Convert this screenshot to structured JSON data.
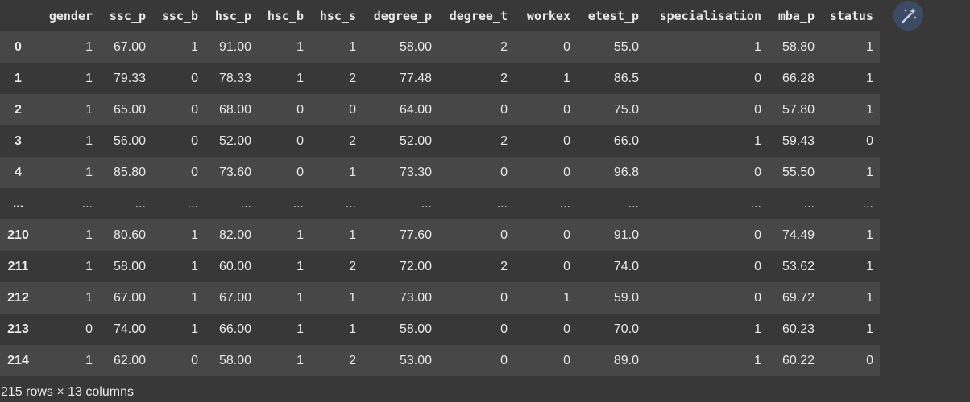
{
  "table": {
    "columns": [
      "",
      "gender",
      "ssc_p",
      "ssc_b",
      "hsc_p",
      "hsc_b",
      "hsc_s",
      "degree_p",
      "degree_t",
      "workex",
      "etest_p",
      "specialisation",
      "mba_p",
      "status"
    ],
    "rows": [
      [
        "0",
        "1",
        "67.00",
        "1",
        "91.00",
        "1",
        "1",
        "58.00",
        "2",
        "0",
        "55.0",
        "1",
        "58.80",
        "1"
      ],
      [
        "1",
        "1",
        "79.33",
        "0",
        "78.33",
        "1",
        "2",
        "77.48",
        "2",
        "1",
        "86.5",
        "0",
        "66.28",
        "1"
      ],
      [
        "2",
        "1",
        "65.00",
        "0",
        "68.00",
        "0",
        "0",
        "64.00",
        "0",
        "0",
        "75.0",
        "0",
        "57.80",
        "1"
      ],
      [
        "3",
        "1",
        "56.00",
        "0",
        "52.00",
        "0",
        "2",
        "52.00",
        "2",
        "0",
        "66.0",
        "1",
        "59.43",
        "0"
      ],
      [
        "4",
        "1",
        "85.80",
        "0",
        "73.60",
        "0",
        "1",
        "73.30",
        "0",
        "0",
        "96.8",
        "0",
        "55.50",
        "1"
      ],
      [
        "...",
        "...",
        "...",
        "...",
        "...",
        "...",
        "...",
        "...",
        "...",
        "...",
        "...",
        "...",
        "...",
        "..."
      ],
      [
        "210",
        "1",
        "80.60",
        "1",
        "82.00",
        "1",
        "1",
        "77.60",
        "0",
        "0",
        "91.0",
        "0",
        "74.49",
        "1"
      ],
      [
        "211",
        "1",
        "58.00",
        "1",
        "60.00",
        "1",
        "2",
        "72.00",
        "2",
        "0",
        "74.0",
        "0",
        "53.62",
        "1"
      ],
      [
        "212",
        "1",
        "67.00",
        "1",
        "67.00",
        "1",
        "1",
        "73.00",
        "0",
        "1",
        "59.0",
        "0",
        "69.72",
        "1"
      ],
      [
        "213",
        "0",
        "74.00",
        "1",
        "66.00",
        "1",
        "1",
        "58.00",
        "0",
        "0",
        "70.0",
        "1",
        "60.23",
        "1"
      ],
      [
        "214",
        "1",
        "62.00",
        "0",
        "58.00",
        "1",
        "2",
        "53.00",
        "0",
        "0",
        "89.0",
        "1",
        "60.22",
        "0"
      ]
    ]
  },
  "footer": {
    "shape_text": "215 rows × 13 columns"
  },
  "magic_button": {
    "icon": "magic-wand-icon",
    "color": "#3d4a63",
    "icon_color": "#c7d4ee"
  }
}
